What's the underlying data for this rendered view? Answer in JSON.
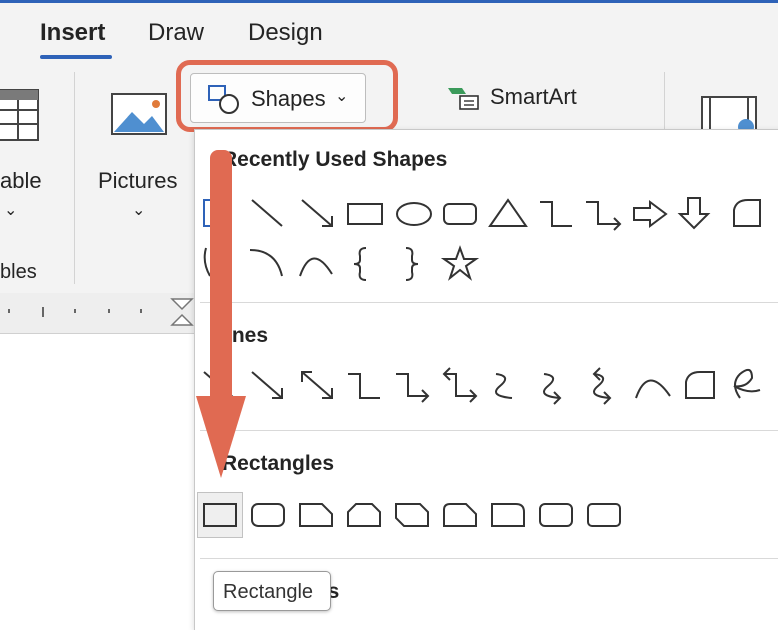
{
  "tabs": [
    {
      "label": "Insert",
      "active": true
    },
    {
      "label": "Draw",
      "active": false
    },
    {
      "label": "Design",
      "active": false
    }
  ],
  "ribbon": {
    "table_label": "able",
    "tables_group_label": "bles",
    "pictures_label": "Pictures",
    "shapes_label": "Shapes",
    "smartart_label": "SmartArt"
  },
  "shapes_gallery": {
    "sections": [
      {
        "title": "Recently Used Shapes"
      },
      {
        "title": "ines"
      },
      {
        "title": "Rectangles"
      },
      {
        "title": "es"
      }
    ],
    "tooltip": "Rectangle"
  },
  "colors": {
    "accent": "#2e62b8",
    "annotation": "#e06a52"
  }
}
